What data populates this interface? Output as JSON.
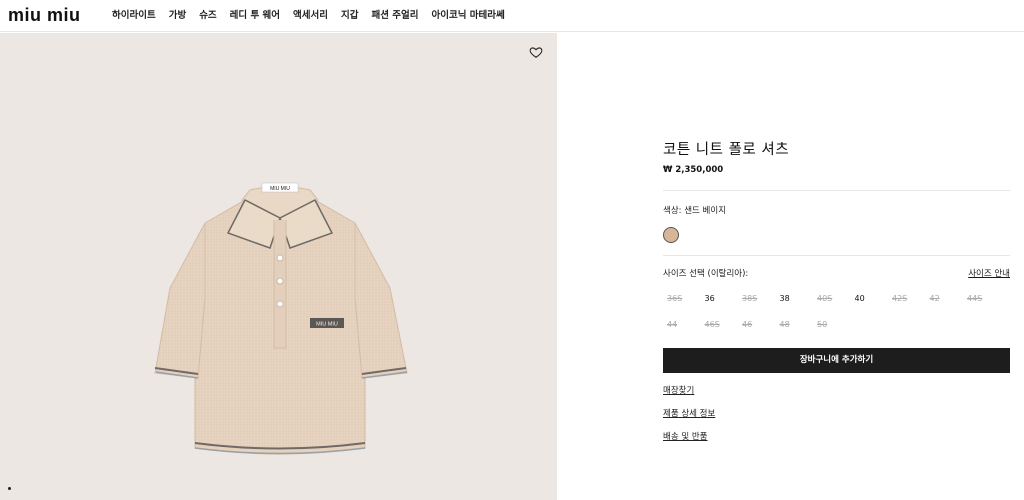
{
  "header": {
    "logo": "miu miu",
    "nav": [
      "하이라이트",
      "가방",
      "슈즈",
      "레디 투 웨어",
      "액세서리",
      "지갑",
      "패션 주얼리",
      "아이코닉 마테라쎄"
    ]
  },
  "product": {
    "title": "코튼 니트 폴로 셔츠",
    "price": "₩ 2,350,000",
    "color_label": "색상: 샌드 베이지",
    "swatch_color": "#d8b596",
    "garment_label": "MIU MIU",
    "size_label": "사이즈 선택 (이탈리아):",
    "size_guide": "사이즈 안내",
    "sizes": [
      {
        "label": "36S",
        "available": false
      },
      {
        "label": "36",
        "available": true
      },
      {
        "label": "38S",
        "available": false
      },
      {
        "label": "38",
        "available": true
      },
      {
        "label": "40S",
        "available": false
      },
      {
        "label": "40",
        "available": true
      },
      {
        "label": "42S",
        "available": false
      },
      {
        "label": "42",
        "available": false
      },
      {
        "label": "44S",
        "available": false
      },
      {
        "label": "44",
        "available": false
      },
      {
        "label": "46S",
        "available": false
      },
      {
        "label": "46",
        "available": false
      },
      {
        "label": "48",
        "available": false
      },
      {
        "label": "50",
        "available": false
      }
    ],
    "add_to_cart": "장바구니에 추가하기",
    "links": [
      "매장찾기",
      "제품 상세 정보",
      "배송 및 반품"
    ]
  },
  "colors": {
    "image_bg": "#ece7e2",
    "button_bg": "#1d1d1d"
  }
}
